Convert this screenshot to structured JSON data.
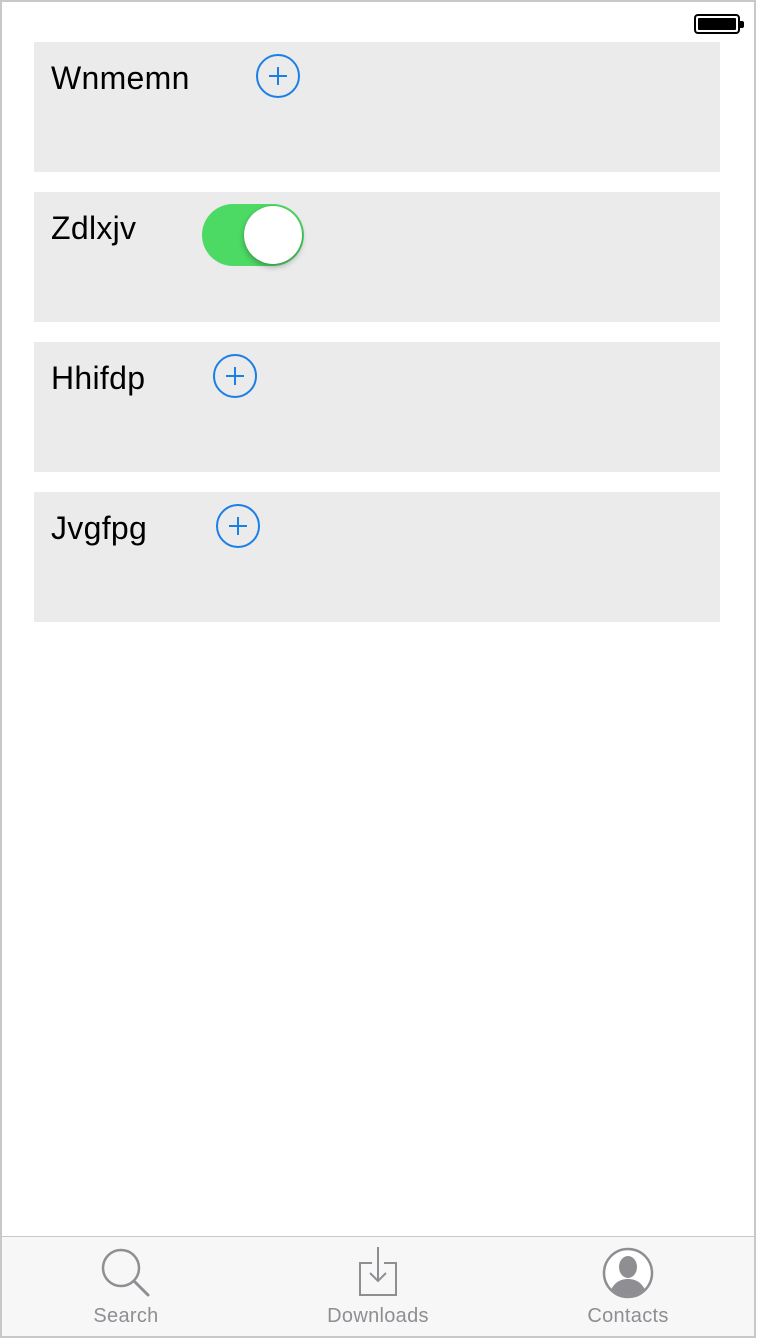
{
  "rows": [
    {
      "label": "Wnmemn",
      "control": "add-button"
    },
    {
      "label": "Zdlxjv",
      "control": "toggle",
      "toggle_on": true
    },
    {
      "label": "Hhifdp",
      "control": "add-button"
    },
    {
      "label": "Jvgfpg",
      "control": "add-button"
    }
  ],
  "tabs": [
    {
      "label": "Search",
      "icon": "search-icon"
    },
    {
      "label": "Downloads",
      "icon": "download-icon"
    },
    {
      "label": "Contacts",
      "icon": "contact-icon"
    }
  ],
  "colors": {
    "accent": "#1a7fe6",
    "toggle_on": "#4cd964",
    "card_bg": "#ebebeb",
    "tab_inactive": "#8e8e93"
  },
  "status": {
    "battery_icon": "battery-full-icon"
  }
}
